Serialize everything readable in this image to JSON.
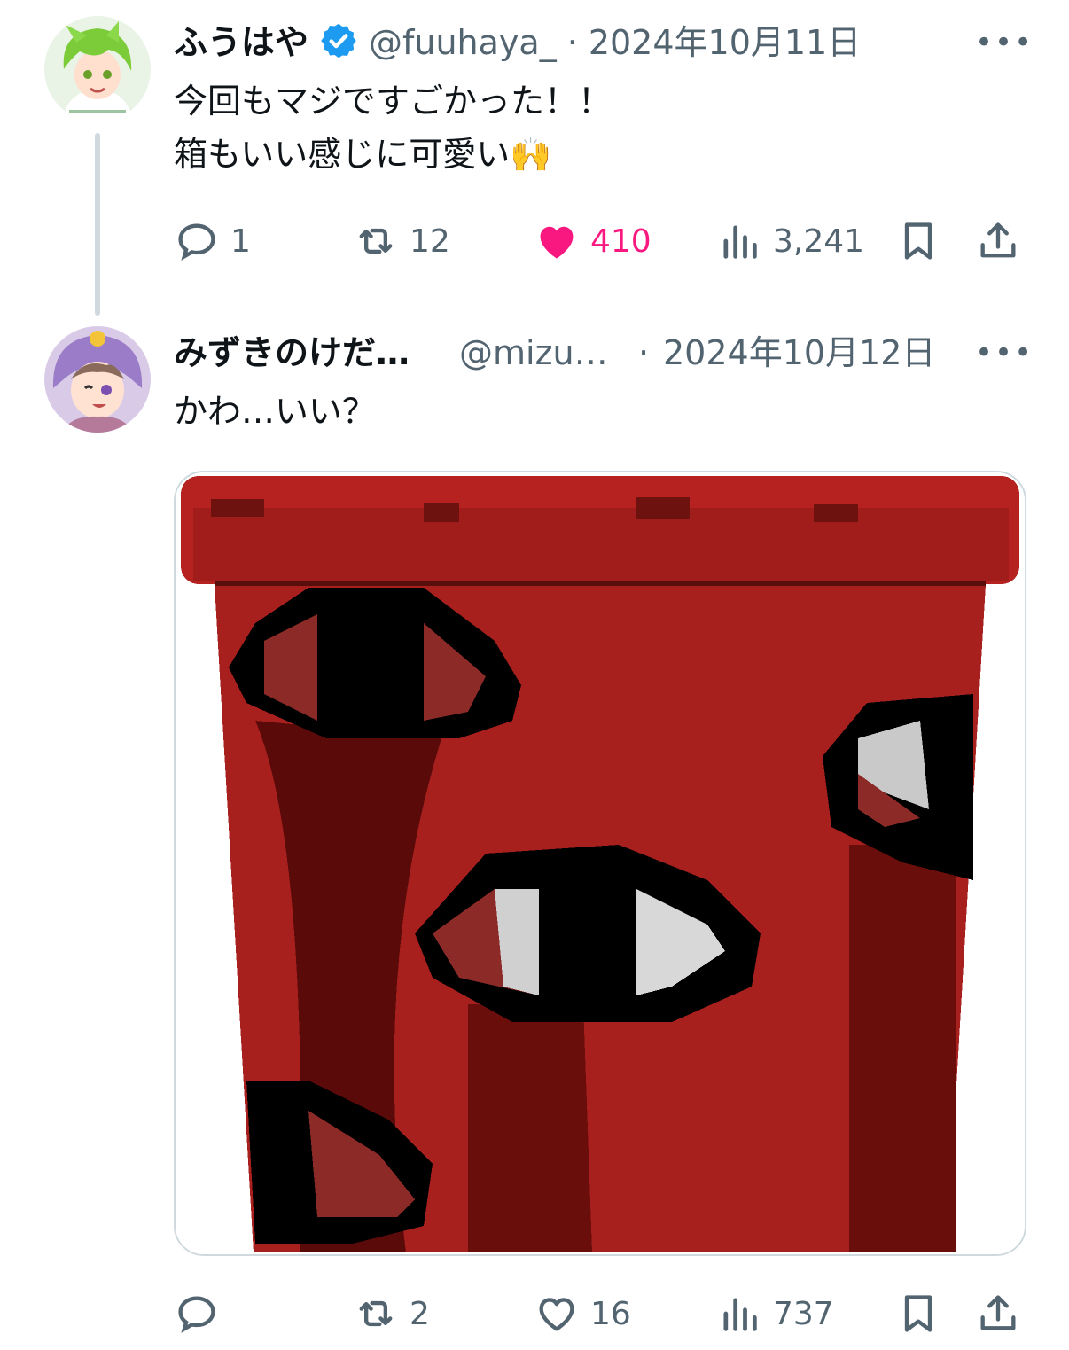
{
  "tweets": [
    {
      "display_name": "ふうはや",
      "verified": true,
      "handle": "@fuuhaya_",
      "separator": "·",
      "date": "2024年10月11日",
      "more": "•••",
      "text": "今回もマジですごかった！！\n箱もいい感じに可愛い🙌",
      "actions": {
        "replies": "1",
        "reposts": "12",
        "likes": "410",
        "views": "3,241",
        "liked": true
      }
    },
    {
      "display_name": "みずきのけだ…",
      "verified": false,
      "handle": "@mizu…",
      "separator": "·",
      "date": "2024年10月12日",
      "more": "•••",
      "text": "かわ…いい？",
      "actions": {
        "replies": "",
        "reposts": "2",
        "likes": "16",
        "views": "737",
        "liked": false
      }
    }
  ],
  "colors": {
    "text_primary": "#0f1419",
    "text_secondary": "#536471",
    "like_active": "#f91880",
    "verified_blue": "#1d9bf0",
    "box_red": "#a8201e"
  },
  "icons": [
    "reply-icon",
    "repost-icon",
    "like-icon",
    "views-icon",
    "bookmark-icon",
    "share-icon",
    "verified-badge-icon",
    "more-icon"
  ]
}
